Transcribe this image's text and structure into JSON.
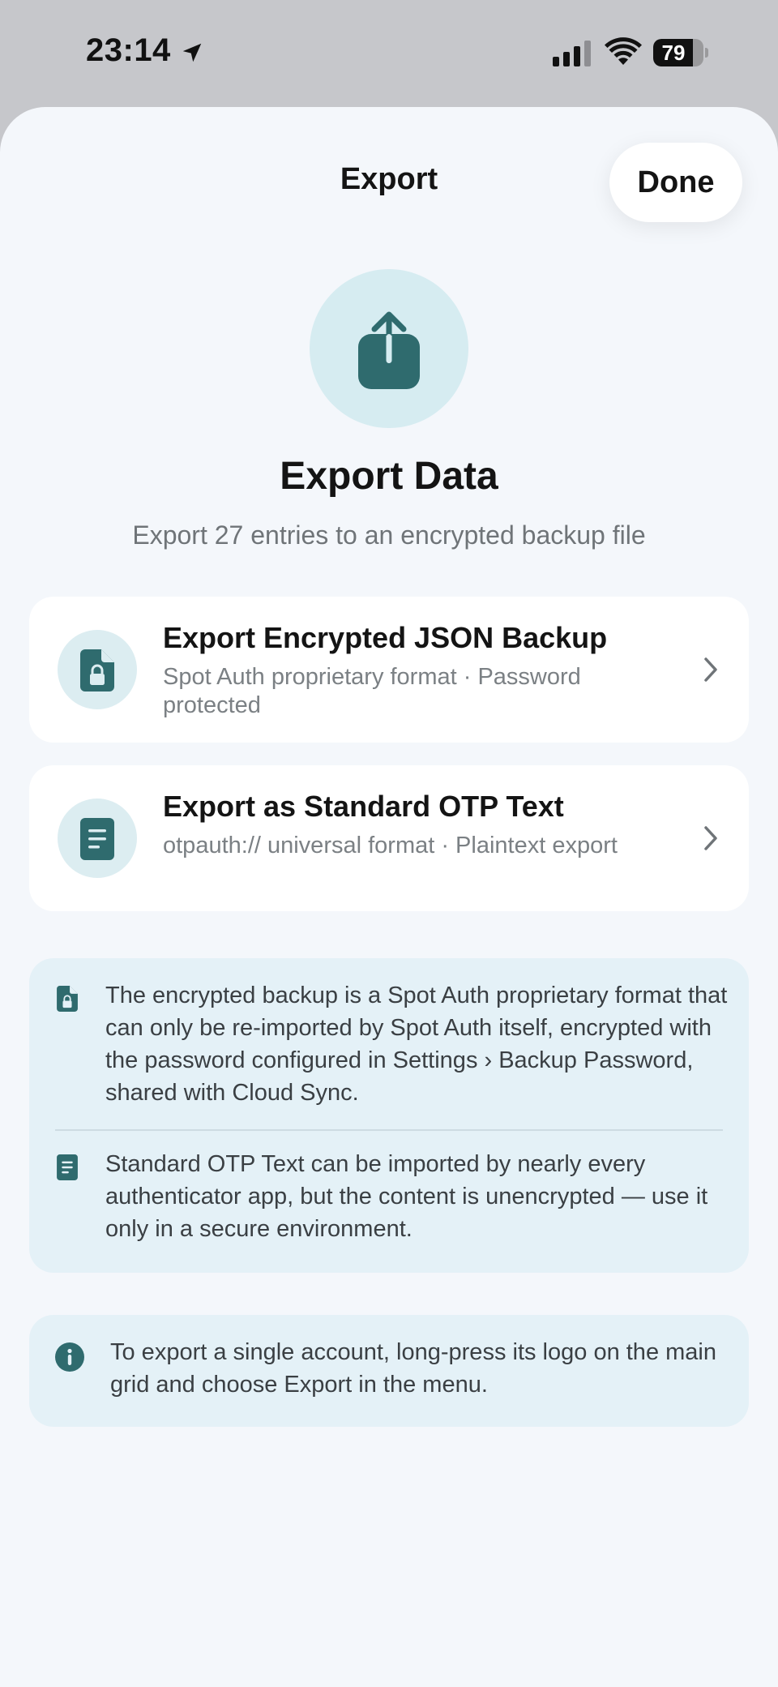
{
  "status_bar": {
    "time": "23:14",
    "battery_level": "79",
    "icons": [
      "location-arrow-icon",
      "cellular-signal-icon",
      "wifi-icon",
      "battery-icon"
    ]
  },
  "nav": {
    "title": "Export",
    "done_label": "Done"
  },
  "hero": {
    "icon": "share-upload-icon",
    "title": "Export Data",
    "subtitle": "Export 27 entries to an encrypted backup file"
  },
  "options": [
    {
      "icon": "locked-document-icon",
      "title": "Export Encrypted JSON Backup",
      "subtitle": "Spot Auth proprietary format · Password protected"
    },
    {
      "icon": "text-document-icon",
      "title": "Export as Standard OTP Text",
      "subtitle": "otpauth:// universal format · Plaintext export"
    }
  ],
  "notes": [
    {
      "icon": "locked-document-icon",
      "text": "The encrypted backup is a Spot Auth proprietary format that can only be re-imported by Spot Auth itself, encrypted with the password configured in Settings › Backup Password, shared with Cloud Sync."
    },
    {
      "icon": "text-document-icon",
      "text": "Standard OTP Text can be imported by nearly every authenticator app, but the content is unencrypted — use it only in a secure environment."
    }
  ],
  "tip": {
    "icon": "info-icon",
    "text": "To export a single account, long-press its logo on the main grid and choose Export in the menu."
  },
  "colors": {
    "accent": "#2f6b6e",
    "sheet_background": "#f4f7fb",
    "info_card_background": "#e4f1f7",
    "icon_circle_background": "#d6ecf1"
  }
}
